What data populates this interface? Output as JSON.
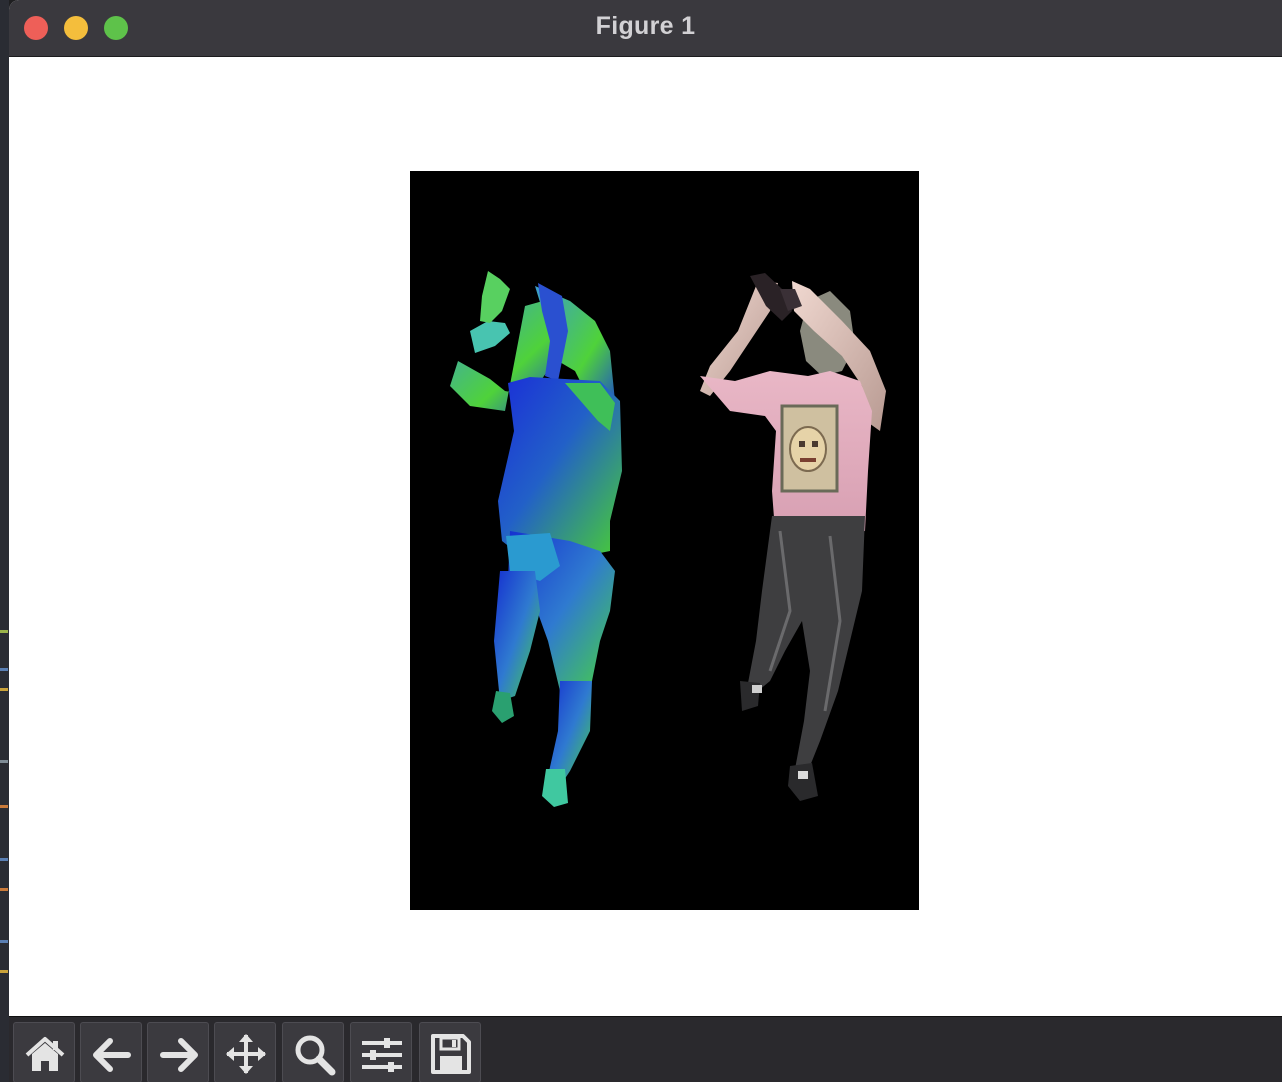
{
  "window": {
    "title": "Figure 1",
    "controls": [
      "close-button",
      "minimize-button",
      "zoom-button"
    ]
  },
  "figure": {
    "panels": [
      "densepose-iuv-render",
      "textured-person-render"
    ],
    "background": "#000000"
  },
  "toolbar": {
    "buttons": [
      {
        "name": "home",
        "icon": "home-icon"
      },
      {
        "name": "back",
        "icon": "arrow-left-icon"
      },
      {
        "name": "forward",
        "icon": "arrow-right-icon"
      },
      {
        "name": "pan",
        "icon": "move-icon"
      },
      {
        "name": "zoom",
        "icon": "magnifier-icon"
      },
      {
        "name": "configure-subplots",
        "icon": "sliders-icon"
      },
      {
        "name": "save",
        "icon": "floppy-disk-icon"
      }
    ]
  },
  "colors": {
    "titlebar": "#3a393e",
    "toolbar": "#2a292d",
    "close": "#ee5f58",
    "minimize": "#f4be3c",
    "zoom": "#5ec24a"
  }
}
